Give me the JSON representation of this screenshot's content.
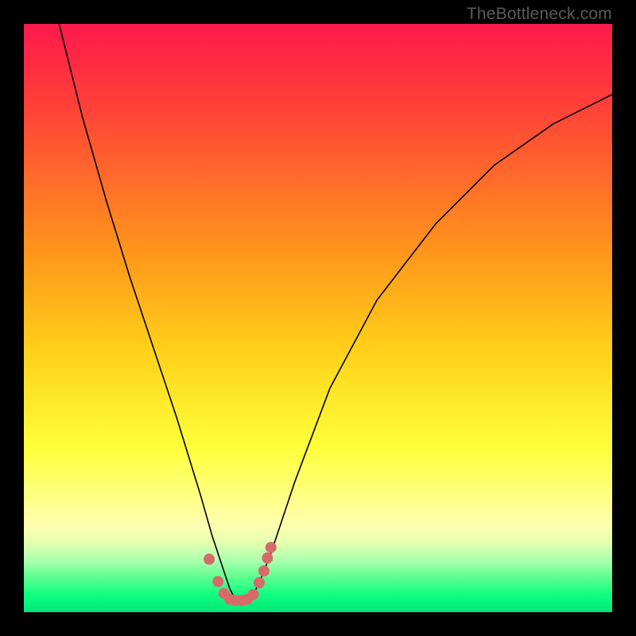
{
  "watermark": "TheBottleneck.com",
  "chart_data": {
    "type": "line",
    "title": "",
    "xlabel": "",
    "ylabel": "",
    "xlim": [
      0,
      100
    ],
    "ylim": [
      0,
      100
    ],
    "grid": false,
    "legend": false,
    "series": [
      {
        "name": "curve",
        "x": [
          6,
          8,
          10,
          14,
          18,
          22,
          26,
          30,
          32,
          34,
          35,
          36,
          37,
          38,
          39,
          40,
          42,
          46,
          52,
          60,
          70,
          80,
          90,
          100
        ],
        "y": [
          100,
          92,
          84,
          70,
          57,
          45,
          33,
          20,
          13,
          7,
          4,
          2,
          2,
          2,
          3,
          5,
          10,
          22,
          38,
          53,
          66,
          76,
          83,
          88
        ]
      }
    ],
    "markers": {
      "name": "dots",
      "x": [
        31.5,
        33.0,
        34.0,
        35.0,
        36.0,
        37.0,
        38.0,
        39.0,
        40.0,
        40.8,
        41.4,
        42.0
      ],
      "y": [
        9.0,
        5.2,
        3.2,
        2.2,
        2.0,
        2.0,
        2.2,
        3.0,
        5.0,
        7.0,
        9.2,
        11.0
      ]
    },
    "colors": {
      "curve": "#000000",
      "markers": "#d86a6a",
      "gradient_top": "#ff1a4d",
      "gradient_bottom": "#00e676"
    }
  }
}
